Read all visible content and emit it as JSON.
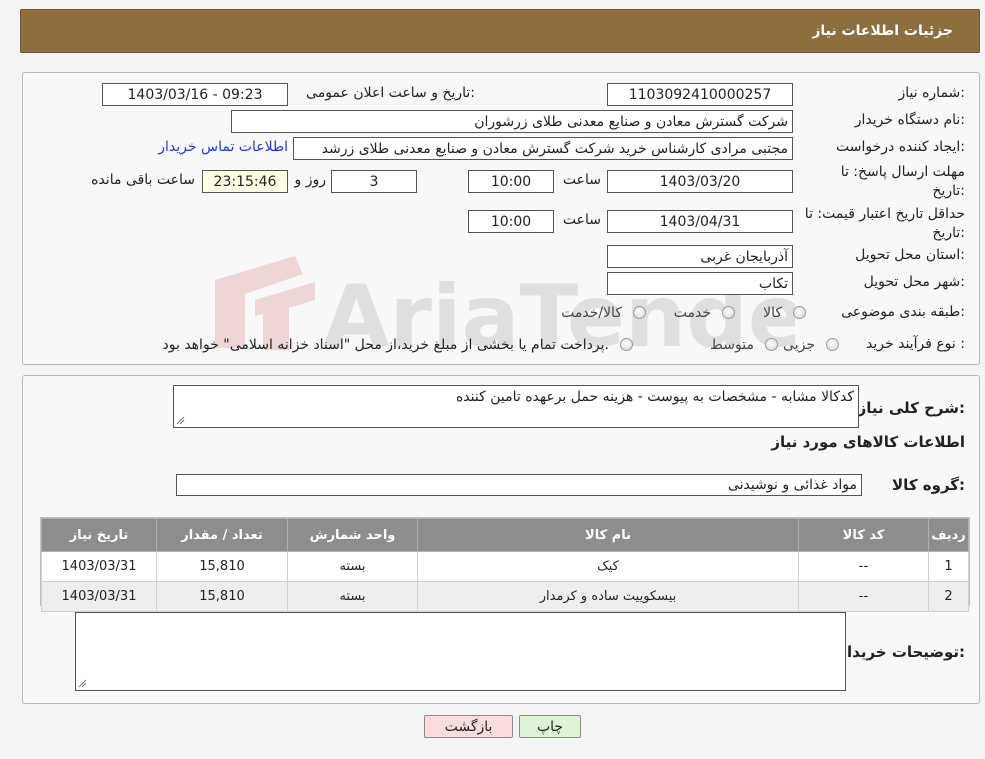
{
  "header": {
    "title": "جزئیات اطلاعات نیاز"
  },
  "form": {
    "need_number_label": "شماره نیاز:",
    "need_number": "1103092410000257",
    "announce_label": "تاریخ و ساعت اعلان عمومی:",
    "announce_value": "1403/03/16 - 09:23",
    "buyer_org_label": "نام دستگاه خریدار:",
    "buyer_org": "شرکت گسترش معادن و صنایع معدنی طلای زرشوران",
    "creator_label": "ایجاد کننده درخواست:",
    "creator": "مجتبی مرادی کارشناس خرید شرکت گسترش معادن و صنایع معدنی طلای زرشد",
    "contact_link": "اطلاعات تماس خریدار",
    "reply_deadline_label": "مهلت ارسال پاسخ: تا تاریخ:",
    "reply_date": "1403/03/20",
    "time_label": "ساعت",
    "reply_time": "10:00",
    "days_value": "3",
    "days_label": "روز و",
    "remaining_time": "23:15:46",
    "remaining_label": "ساعت باقی مانده",
    "price_validity_label": "حداقل تاریخ اعتبار قیمت: تا تاریخ:",
    "price_date": "1403/04/31",
    "price_time": "10:00",
    "province_label": "استان محل تحویل:",
    "province": "آذربایجان غربی",
    "city_label": "شهر محل تحویل:",
    "city": "تکاب",
    "category_label": "طبقه بندی موضوعی:",
    "category_options": [
      "کالا",
      "خدمت",
      "کالا/خدمت"
    ],
    "process_label": "نوع فرآیند خرید :",
    "process_options": [
      "جزیی",
      "متوسط"
    ],
    "payment_note": "پرداخت تمام یا بخشی از مبلغ خرید،از محل \"اسناد خزانه اسلامی\" خواهد بود."
  },
  "details": {
    "summary_label": "شرح کلی نیاز:",
    "summary": "کدکالا مشابه - مشخصات به پیوست - هزینه حمل برعهده تامین کننده",
    "goods_info_title": "اطلاعات کالاهای مورد نیاز",
    "group_label": "گروه کالا:",
    "group_value": "مواد غذائی و نوشیدنی",
    "table": {
      "headers": [
        "ردیف",
        "کد کالا",
        "نام کالا",
        "واحد شمارش",
        "تعداد / مقدار",
        "تاریخ نیاز"
      ],
      "rows": [
        [
          "1",
          "--",
          "کیک",
          "بسته",
          "15,810",
          "1403/03/31"
        ],
        [
          "2",
          "--",
          "بیسکوییت ساده و کرمدار",
          "بسته",
          "15,810",
          "1403/03/31"
        ]
      ]
    },
    "buyer_notes_label": "توضیحات خریدار:",
    "buyer_notes": ""
  },
  "buttons": {
    "print": "چاپ",
    "back": "بازگشت"
  },
  "watermark": "AriaTender.neT",
  "colors": {
    "header_bg": "#8d6e3f",
    "table_header_bg": "#8d8d8d",
    "print_bg": "#ddf5d6",
    "back_bg": "#fbdcdc"
  }
}
